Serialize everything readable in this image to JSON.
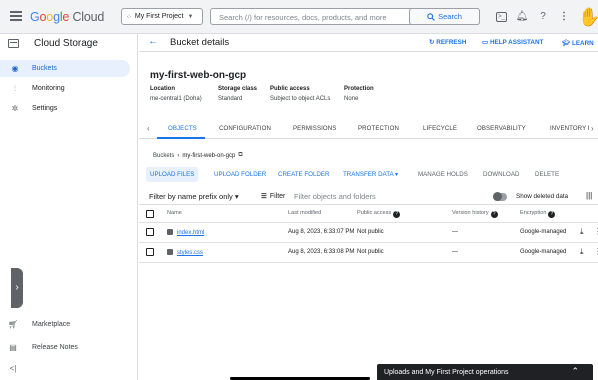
{
  "topbar": {
    "logo_google": [
      "G",
      "o",
      "o",
      "g",
      "l",
      "e"
    ],
    "logo_cloud": "Cloud",
    "project": "My First Project",
    "search_placeholder": "Search (/) for resources, docs, products, and more",
    "search_button": "Search"
  },
  "leftnav": {
    "title": "Cloud Storage",
    "items": [
      {
        "label": "Buckets",
        "icon": "bucket-icon",
        "active": true
      },
      {
        "label": "Monitoring",
        "icon": "monitoring-icon"
      },
      {
        "label": "Settings",
        "icon": "gear-icon"
      }
    ],
    "bottom": [
      {
        "label": "Marketplace",
        "icon": "marketplace-icon"
      },
      {
        "label": "Release Notes",
        "icon": "release-notes-icon"
      }
    ],
    "collapse_glyph": "<|"
  },
  "page": {
    "title": "Bucket details",
    "refresh": "REFRESH",
    "help_assistant": "HELP ASSISTANT",
    "learn": "LEARN"
  },
  "bucket": {
    "name": "my-first-web-on-gcp",
    "info": [
      {
        "label": "Location",
        "value": "me-central1 (Doha)"
      },
      {
        "label": "Storage class",
        "value": "Standard"
      },
      {
        "label": "Public access",
        "value": "Subject to object ACLs"
      },
      {
        "label": "Protection",
        "value": "None"
      }
    ]
  },
  "tabs": [
    "OBJECTS",
    "CONFIGURATION",
    "PERMISSIONS",
    "PROTECTION",
    "LIFECYCLE",
    "OBSERVABILITY",
    "INVENTORY I"
  ],
  "breadcrumb": {
    "root": "Buckets",
    "current": "my-first-web-on-gcp"
  },
  "actions": [
    "UPLOAD FILES",
    "UPLOAD FOLDER",
    "CREATE FOLDER",
    "TRANSFER DATA ▾",
    "MANAGE HOLDS",
    "DOWNLOAD",
    "DELETE"
  ],
  "filter": {
    "select": "Filter by name prefix only",
    "filter_label": "Filter",
    "placeholder": "Filter objects and folders",
    "show_deleted": "Show deleted data"
  },
  "table": {
    "headers": [
      "Name",
      "Last modified",
      "Public access",
      "Version history",
      "Encryption"
    ],
    "rows": [
      {
        "name": "index.html",
        "modified": "Aug 8, 2023, 6:33:07 PM",
        "public": "Not public",
        "version": "—",
        "encryption": "Google-managed"
      },
      {
        "name": "styles.css",
        "modified": "Aug 8, 2023, 6:33:08 PM",
        "public": "Not public",
        "version": "—",
        "encryption": "Google-managed"
      }
    ]
  },
  "ops_bar": "Uploads and My First Project operations",
  "colors": {
    "accent": "#1a73e8",
    "active_bg": "#e8f0fe",
    "topbar_bg": "#f1f3f4"
  }
}
